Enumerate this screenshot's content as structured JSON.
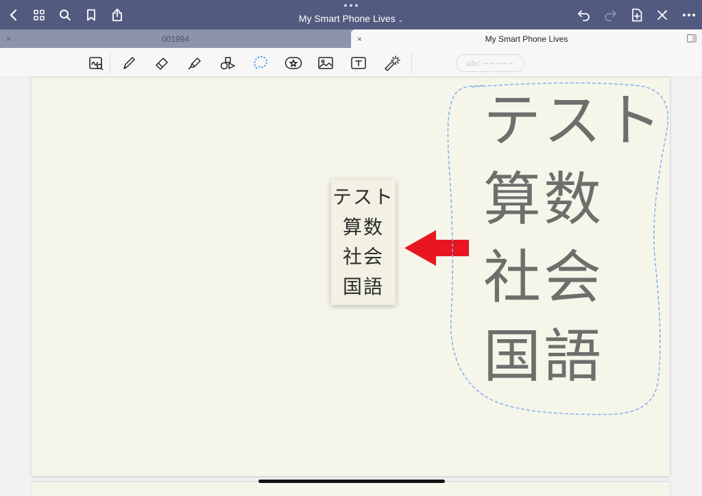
{
  "navbar": {
    "title": "My Smart Phone Lives",
    "icons": [
      "back-icon",
      "grid-icon",
      "search-icon",
      "bookmark-icon",
      "share-icon",
      "undo-icon",
      "redo-icon",
      "add-page-icon",
      "close-x-icon",
      "more-icon"
    ]
  },
  "tabs": [
    {
      "label": "001994",
      "active": false
    },
    {
      "label": "My Smart Phone Lives",
      "active": true
    }
  ],
  "toolbar": {
    "tools": [
      "zoom-window-icon",
      "pen-icon",
      "eraser-icon",
      "highlighter-icon",
      "shapes-icon",
      "lasso-icon",
      "sticker-icon",
      "image-icon",
      "text-box-icon",
      "laser-pointer-icon"
    ],
    "selected_tool": "lasso-icon",
    "handwriting_pill": "abc ~~~~~"
  },
  "canvas": {
    "thumbnail_lines": [
      "テスト",
      "算数",
      "社会",
      "国語"
    ],
    "handwriting_lines": [
      "テスト",
      "算数",
      "社会",
      "国語"
    ],
    "colors": {
      "arrow": "#e8161f",
      "lasso": "#7fb1ea",
      "ink": "#6e6e6c",
      "navbar": "#525b7f",
      "paper": "#f6f5ea"
    }
  }
}
